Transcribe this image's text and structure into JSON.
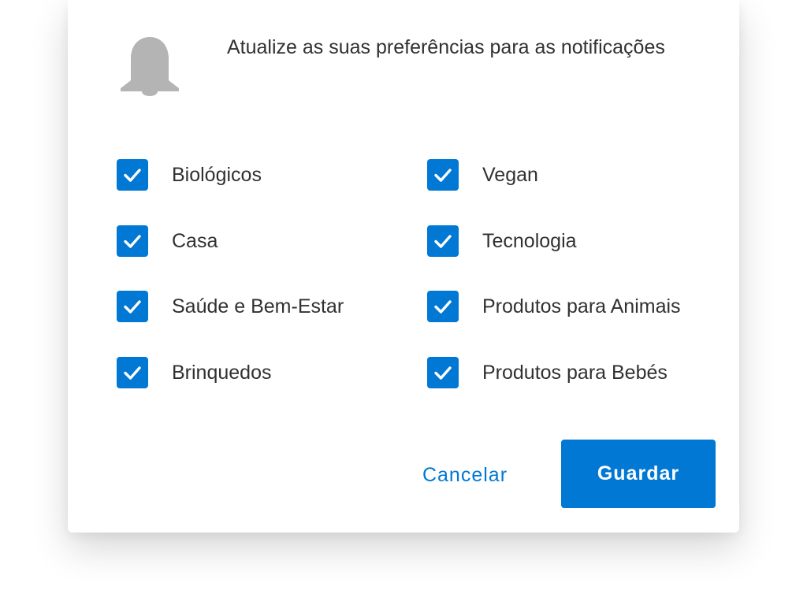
{
  "dialog": {
    "title": "Atualize as suas preferências para as notificações",
    "icon": "bell-icon",
    "options": [
      {
        "label": "Biológicos",
        "checked": true
      },
      {
        "label": "Vegan",
        "checked": true
      },
      {
        "label": "Casa",
        "checked": true
      },
      {
        "label": "Tecnologia",
        "checked": true
      },
      {
        "label": "Saúde e Bem-Estar",
        "checked": true
      },
      {
        "label": "Produtos para Animais",
        "checked": true
      },
      {
        "label": "Brinquedos",
        "checked": true
      },
      {
        "label": "Produtos para Bebés",
        "checked": true
      }
    ],
    "cancel_label": "Cancelar",
    "save_label": "Guardar"
  },
  "colors": {
    "accent": "#0078d4",
    "icon_gray": "#b4b4b4",
    "text": "#323130"
  }
}
